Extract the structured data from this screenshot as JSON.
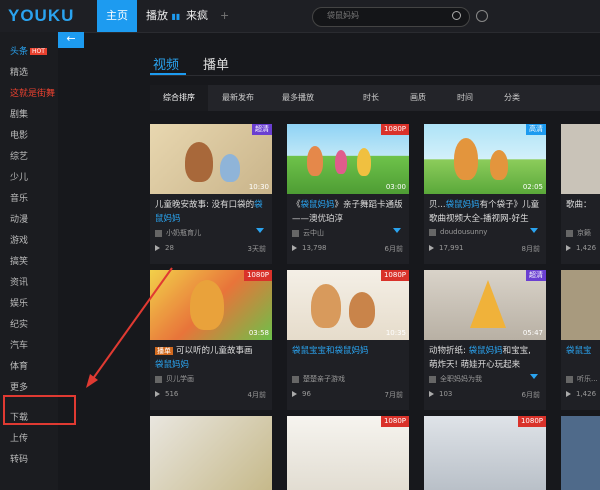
{
  "header": {
    "logo": "YOUKU",
    "home": "主页",
    "broadcast": "播放",
    "laifeng": "来疯",
    "add": "+",
    "search_placeholder": "袋鼠妈妈"
  },
  "sidebar": {
    "items": [
      "头条",
      "精选",
      "这就是街舞",
      "剧集",
      "电影",
      "综艺",
      "少儿",
      "音乐",
      "动漫",
      "游戏",
      "搞笑",
      "资讯",
      "娱乐",
      "纪实",
      "汽车",
      "体育",
      "更多",
      "下载",
      "上传",
      "转码"
    ],
    "hot_badge": "HOT",
    "collapse": "←"
  },
  "tabs": [
    "视频",
    "播单"
  ],
  "filters": [
    "综合排序",
    "最新发布",
    "最多播放",
    "时长",
    "画质",
    "时间",
    "分类"
  ],
  "cards": [
    {
      "badge": "超清",
      "badge_color": "#6a3fd1",
      "dur": "10:30",
      "title_a": "儿童晚安故事: 没有口袋的",
      "title_b": "袋鼠妈妈",
      "author": "小奶瓶育儿",
      "plays": "28",
      "time": "3天前"
    },
    {
      "badge": "1080P",
      "badge_color": "#d9322a",
      "dur": "03:00",
      "title_a": "《",
      "title_mid": "袋鼠妈妈",
      "title_b": "》亲子舞蹈卡通版——澳优珀淳",
      "author": "云中山",
      "plays": "13,798",
      "time": "6月前"
    },
    {
      "badge": "高清",
      "badge_color": "#1d9bf0",
      "dur": "02:05",
      "title_a": "贝...",
      "title_mid": "袋鼠妈妈",
      "title_b": "有个袋子》儿童歌曲视频大全-播视网-好生",
      "author": "doudousunny",
      "plays": "17,991",
      "time": "8月前"
    },
    {
      "badge": "",
      "badge_color": "",
      "dur": "",
      "title_a": "歌曲：",
      "title_b": "",
      "author": "京籁",
      "plays": "1,426",
      "time": ""
    },
    {
      "badge": "1080P",
      "badge_color": "#d9322a",
      "dur": "03:58",
      "tag": "播单",
      "title_a": "可以听的儿童故事画",
      "title_b": "袋鼠妈妈",
      "author": "贝儿学画",
      "plays": "516",
      "time": "4月前"
    },
    {
      "badge": "1080P",
      "badge_color": "#d9322a",
      "dur": "10:35",
      "title_a": "",
      "title_mid": "袋鼠宝宝和",
      "title_b": "袋鼠妈妈",
      "author": "楚楚亲子游戏",
      "plays": "96",
      "time": "7月前"
    },
    {
      "badge": "超清",
      "badge_color": "#6a3fd1",
      "dur": "05:47",
      "title_a": "动物折纸: ",
      "title_mid": "袋鼠妈妈",
      "title_b": "和宝宝, 萌炸天! 萌娃开心玩起来",
      "author": "全职妈妈为我",
      "plays": "103",
      "time": "6月前"
    },
    {
      "badge": "",
      "badge_color": "",
      "dur": "",
      "title_a": "",
      "title_b": "袋鼠宝",
      "author": "听乐...",
      "plays": "1,426",
      "time": ""
    }
  ]
}
